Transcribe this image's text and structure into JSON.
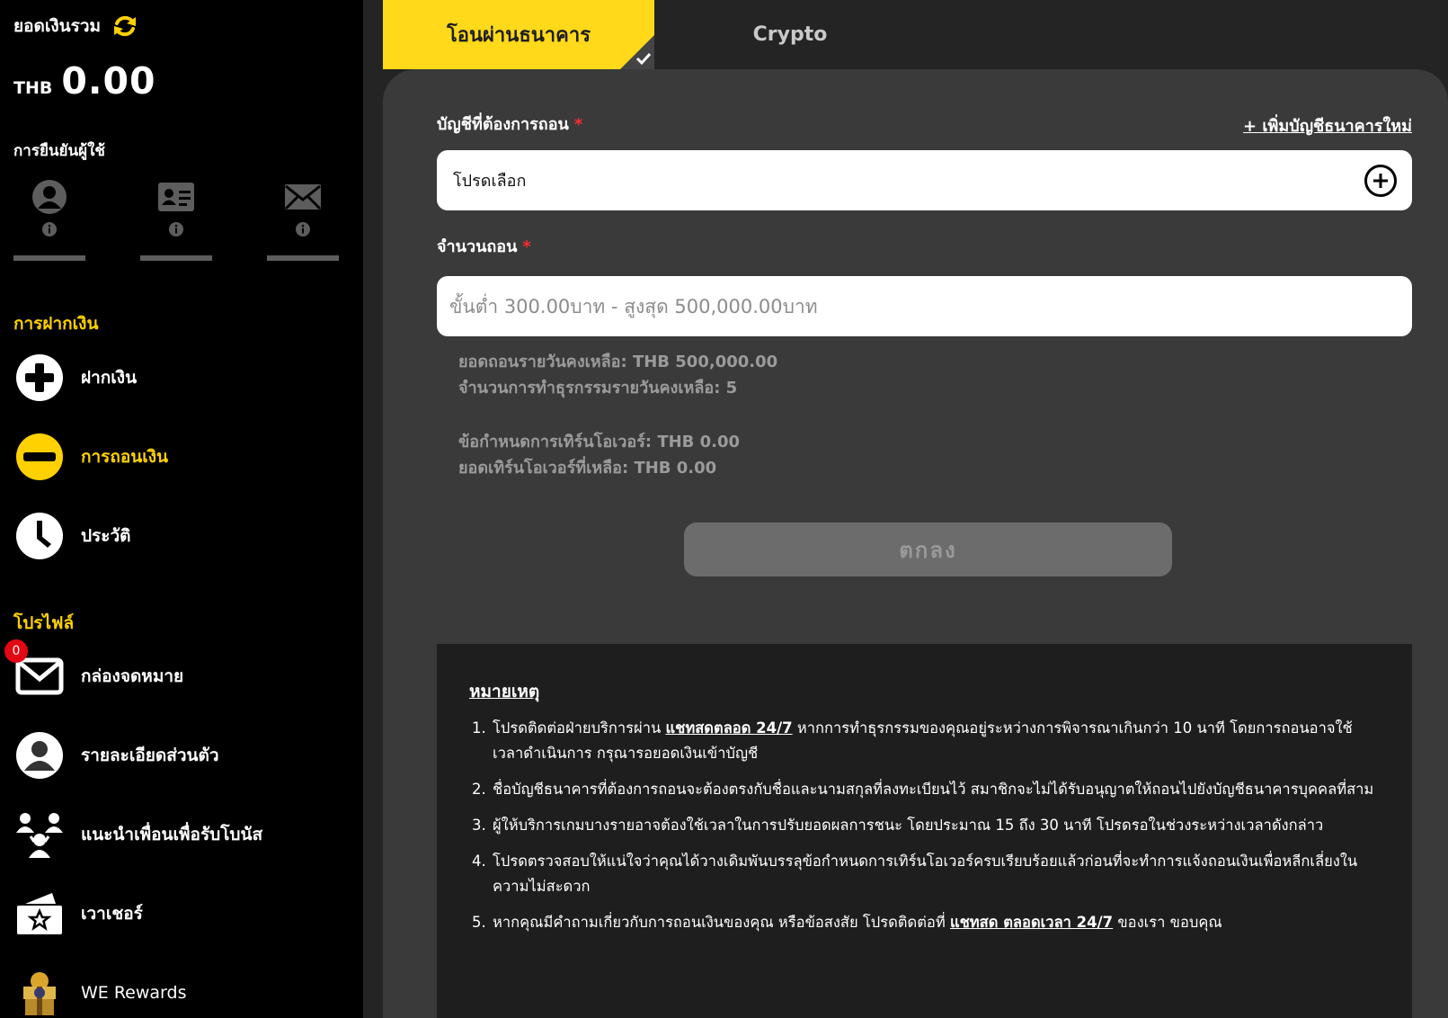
{
  "balance": {
    "label": "ยอดเงินรวม",
    "currency": "THB",
    "amount": "0.00"
  },
  "verification": {
    "title": "การยืนยันผู้ใช้",
    "items": [
      {
        "icon": "user-avatar-icon"
      },
      {
        "icon": "id-card-icon"
      },
      {
        "icon": "envelope-icon"
      }
    ]
  },
  "deposit_section": {
    "title": "การฝากเงิน",
    "items": [
      {
        "label": "ฝากเงิน",
        "icon": "plus-circle-icon"
      },
      {
        "label": "การถอนเงิน",
        "icon": "minus-circle-icon",
        "active": true
      },
      {
        "label": "ประวัติ",
        "icon": "clock-icon"
      }
    ]
  },
  "profile_section": {
    "title": "โปรไฟล์",
    "items": [
      {
        "label": "กล่องจดหมาย",
        "icon": "mail-icon",
        "badge": "0"
      },
      {
        "label": "รายละเอียดส่วนตัว",
        "icon": "user-circle-icon"
      },
      {
        "label": "แนะนำเพื่อนเพื่อรับโบนัส",
        "icon": "referral-icon"
      },
      {
        "label": "เวาเชอร์",
        "icon": "voucher-icon"
      },
      {
        "label": "WE Rewards",
        "icon": "rewards-icon"
      }
    ]
  },
  "tabs": [
    {
      "label": "โอนผ่านธนาคาร",
      "active": true
    },
    {
      "label": "Crypto",
      "active": false
    }
  ],
  "form": {
    "account_label": "บัญชีที่ต้องการถอน",
    "required_mark": "*",
    "add_account_link": "+ เพิ่มบัญชีธนาคารใหม่",
    "account_select_value": "โปรดเลือก",
    "amount_label": "จำนวนถอน",
    "amount_placeholder": "ขั้นต่ำ 300.00บาท - สูงสุด 500,000.00บาท",
    "daily_remaining": "ยอดถอนรายวันคงเหลือ: THB 500,000.00",
    "daily_tx_remaining": "จำนวนการทำธุรกรรมรายวันคงเหลือ: 5",
    "turnover_req": "ข้อกำหนดการเทิร์นโอเวอร์: THB 0.00",
    "turnover_remaining": "ยอดเทิร์นโอเวอร์ที่เหลือ: THB 0.00",
    "confirm_label": "ตกลง"
  },
  "notes": {
    "title": "หมายเหตุ",
    "items": [
      {
        "pre": "โปรดติดต่อฝ่ายบริการผ่าน ",
        "link": "แชทสดตลอด 24/7",
        "post": " หากการทำธุรกรรมของคุณอยู่ระหว่างการพิจารณาเกินกว่า 10 นาที โดยการถอนอาจใช้เวลาดำเนินการ กรุณารอยอดเงินเข้าบัญชี"
      },
      {
        "pre": "ชื่อบัญชีธนาคารที่ต้องการถอนจะต้องตรงกับชื่อและนามสกุลที่ลงทะเบียนไว้ สมาชิกจะไม่ได้รับอนุญาตให้ถอนไปยังบัญชีธนาคารบุคคลที่สาม",
        "link": "",
        "post": ""
      },
      {
        "pre": "ผู้ให้บริการเกมบางรายอาจต้องใช้เวลาในการปรับยอดผลการชนะ โดยประมาณ 15 ถึง 30 นาที โปรดรอในช่วงระหว่างเวลาดังกล่าว",
        "link": "",
        "post": ""
      },
      {
        "pre": "โปรดตรวจสอบให้แน่ใจว่าคุณได้วางเดิมพันบรรลุข้อกำหนดการเทิร์นโอเวอร์ครบเรียบร้อยแล้วก่อนที่จะทำการแจ้งถอนเงินเพื่อหลีกเลี่ยงในความไม่สะดวก",
        "link": "",
        "post": ""
      },
      {
        "pre": "หากคุณมีคำถามเกี่ยวกับการถอนเงินของคุณ หรือข้อสงสัย โปรดติดต่อที่ ",
        "link": "แชทสด ตลอดเวลา 24/7",
        "post": " ของเรา ขอบคุณ"
      }
    ]
  },
  "colors": {
    "accent": "#ffd100",
    "tab_active_bg": "#ffd91a",
    "panel_bg": "#3a3a3a",
    "notes_bg": "#1e1e1e",
    "required": "#ff2b2b",
    "badge": "#e30613"
  }
}
